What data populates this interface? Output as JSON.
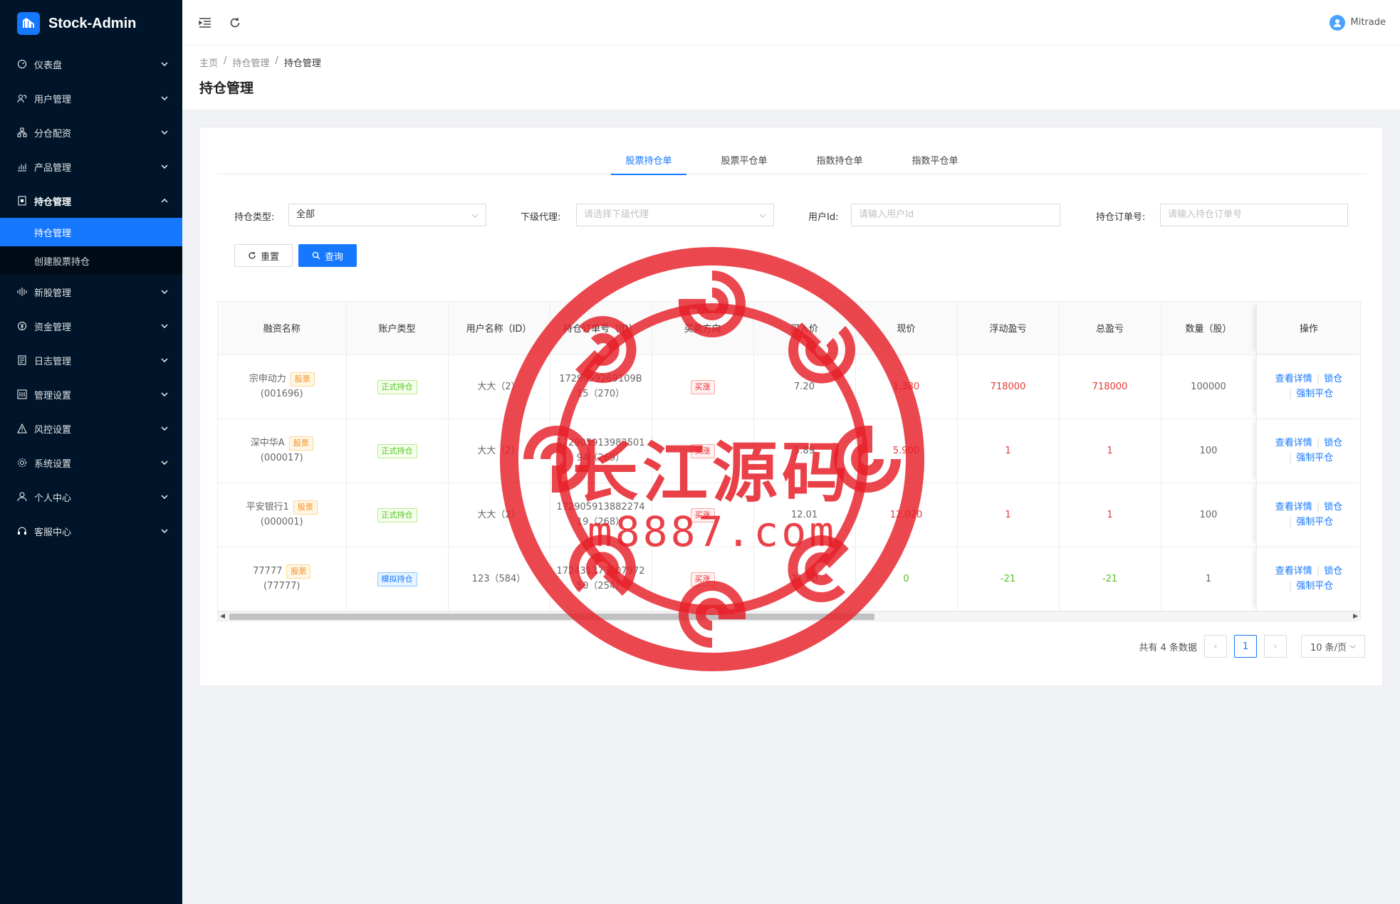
{
  "app": {
    "title": "Stock-Admin"
  },
  "sidebar": {
    "items": [
      {
        "label": "仪表盘",
        "icon": "dashboard-icon"
      },
      {
        "label": "用户管理",
        "icon": "user-group-icon"
      },
      {
        "label": "分仓配资",
        "icon": "cluster-icon"
      },
      {
        "label": "产品管理",
        "icon": "bar-chart-icon"
      },
      {
        "label": "持仓管理",
        "icon": "position-icon",
        "open": true,
        "children": [
          {
            "label": "持仓管理",
            "active": true
          },
          {
            "label": "创建股票持仓"
          }
        ]
      },
      {
        "label": "新股管理",
        "icon": "sound-icon"
      },
      {
        "label": "资金管理",
        "icon": "money-icon"
      },
      {
        "label": "日志管理",
        "icon": "log-icon"
      },
      {
        "label": "管理设置",
        "icon": "settings-panel-icon"
      },
      {
        "label": "风控设置",
        "icon": "warning-icon"
      },
      {
        "label": "系统设置",
        "icon": "gear-icon"
      },
      {
        "label": "个人中心",
        "icon": "person-icon"
      },
      {
        "label": "客服中心",
        "icon": "headset-icon"
      }
    ]
  },
  "header": {
    "user_name": "Mitrade"
  },
  "breadcrumb": {
    "home": "主页",
    "level1": "持仓管理",
    "level2": "持仓管理",
    "sep": "/"
  },
  "page_title": "持仓管理",
  "tabs": [
    "股票持仓单",
    "股票平仓单",
    "指数持仓单",
    "指数平仓单"
  ],
  "filters": {
    "position_type_label": "持仓类型:",
    "position_type_value": "全部",
    "agent_label": "下级代理:",
    "agent_placeholder": "请选择下级代理",
    "user_id_label": "用户Id:",
    "user_id_placeholder": "请输入用户Id",
    "order_no_label": "持仓订单号:",
    "order_no_placeholder": "请输入持仓订单号"
  },
  "buttons": {
    "reset": "重置",
    "query": "查询"
  },
  "table": {
    "headers": [
      "融资名称",
      "账户类型",
      "用户名称（ID）",
      "持仓订单号（ID）",
      "买卖方向",
      "买入价",
      "现价",
      "浮动盈亏",
      "总盈亏",
      "数量（股）",
      "操作"
    ],
    "rows": [
      {
        "name": "宗申动力",
        "tag": "股票",
        "code": "(001696)",
        "account_type": "正式持仓",
        "account_style": "green",
        "user": "大大（2）",
        "order_line1": "1729059269109B",
        "order_line2": "15（270）",
        "direction": "买涨",
        "buy_price": "7.20",
        "current_price": "1.380",
        "current_color": "red",
        "float_pl": "718000",
        "float_color": "red",
        "total_pl": "718000",
        "total_color": "red",
        "quantity": "100000"
      },
      {
        "name": "深中华A",
        "tag": "股票",
        "code": "(000017)",
        "account_type": "正式持仓",
        "account_style": "green",
        "user": "大大（2）",
        "order_line1": "172905913983501",
        "order_line2": "94（269）",
        "direction": "买涨",
        "buy_price": "5.89",
        "current_price": "5.900",
        "current_color": "red",
        "float_pl": "1",
        "float_color": "red",
        "total_pl": "1",
        "total_color": "red",
        "quantity": "100"
      },
      {
        "name": "平安银行1",
        "tag": "股票",
        "code": "(000001)",
        "account_type": "正式持仓",
        "account_style": "green",
        "user": "大大（2）",
        "order_line1": "172905913882274",
        "order_line2": "19（268）",
        "direction": "买涨",
        "buy_price": "12.01",
        "current_price": "12.020",
        "current_color": "red",
        "float_pl": "1",
        "float_color": "red",
        "total_pl": "1",
        "total_color": "red",
        "quantity": "100"
      },
      {
        "name": "77777",
        "tag": "股票",
        "code": "(77777)",
        "account_type": "模拟持仓",
        "account_style": "blue",
        "user": "123（584）",
        "order_line1": "172431373507972",
        "order_line2": "50（254）",
        "direction": "买涨",
        "buy_price": "21.00",
        "current_price": "0",
        "current_color": "green",
        "float_pl": "-21",
        "float_color": "green",
        "total_pl": "-21",
        "total_color": "green",
        "quantity": "1"
      }
    ],
    "ops": {
      "detail": "查看详情",
      "lock": "锁仓",
      "force_close": "强制平仓",
      "sep": "|"
    }
  },
  "pagination": {
    "total_text": "共有 4 条数据",
    "current_page": "1",
    "page_size": "10 条/页"
  },
  "watermark": {
    "title": "长江源码",
    "url": "m8887.com"
  },
  "colors": {
    "sidebar_bg": "#001529",
    "primary": "#1677ff",
    "stamp_red": "#e61e28"
  }
}
